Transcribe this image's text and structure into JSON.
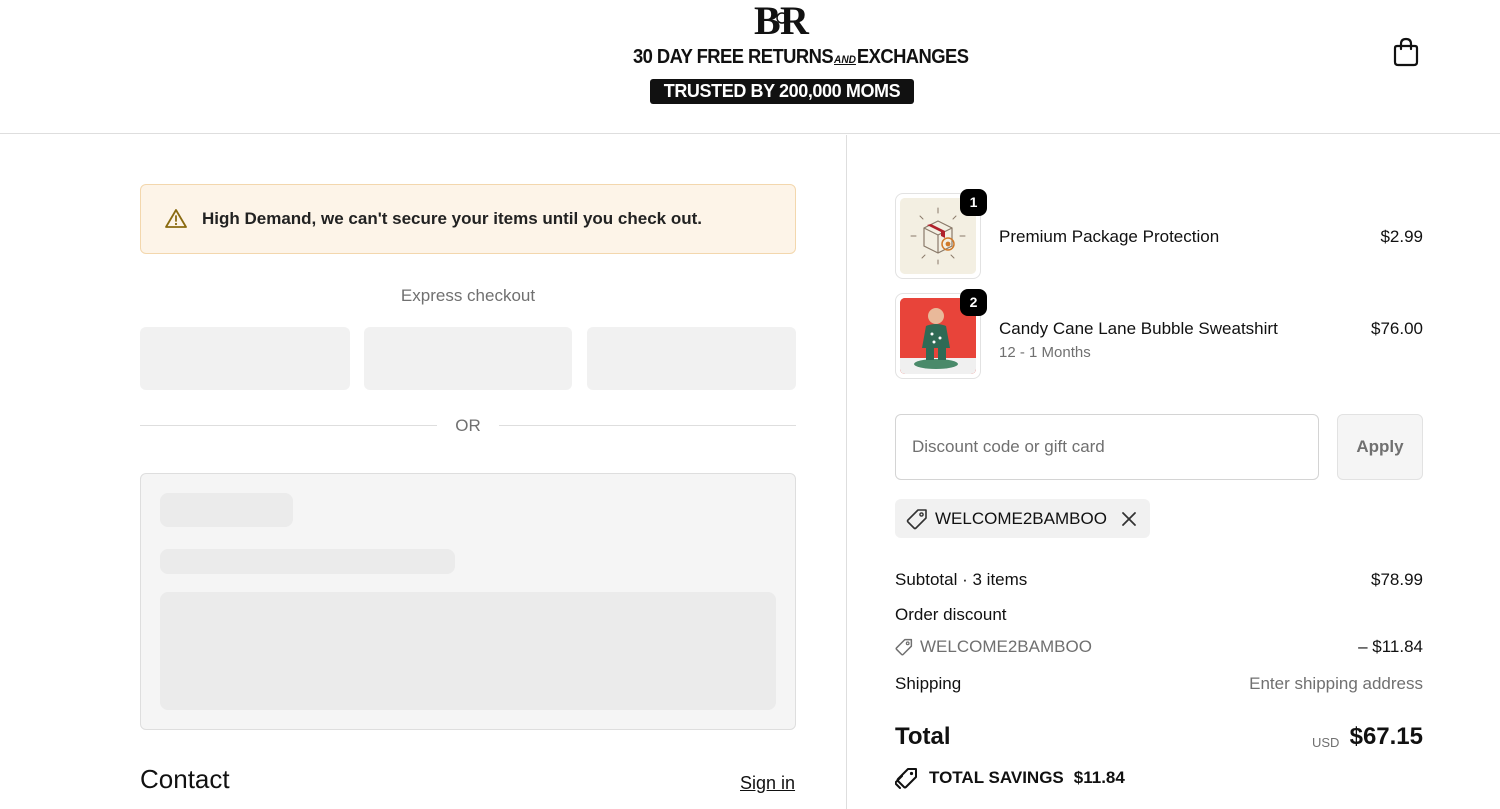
{
  "header": {
    "logo_line1_a": "30 DAY FREE RETURNS",
    "logo_line1_and": "AND",
    "logo_line1_b": "EXCHANGES",
    "logo_line2": "TRUSTED BY 200,000 MOMS",
    "cart_icon": "shopping-bag-icon"
  },
  "banner": {
    "icon": "warning-icon",
    "text": "High Demand, we can't secure your items until you check out.",
    "background": "#fdf4e8",
    "border": "#f3d7ad"
  },
  "express": {
    "label": "Express checkout",
    "or_label": "OR"
  },
  "contact": {
    "title": "Contact",
    "sign_in": "Sign in"
  },
  "cart": {
    "items": [
      {
        "name": "Premium Package Protection",
        "variant": "",
        "price": "$2.99",
        "quantity": "1"
      },
      {
        "name": "Candy Cane Lane Bubble Sweatshirt",
        "variant": "12 - 1 Months",
        "price": "$76.00",
        "quantity": "2"
      }
    ]
  },
  "discount": {
    "placeholder": "Discount code or gift card",
    "apply_label": "Apply",
    "applied_code": "WELCOME2BAMBOO"
  },
  "summary": {
    "subtotal_label": "Subtotal · 3 items",
    "subtotal_value": "$78.99",
    "order_discount_label": "Order discount",
    "discount_code": "WELCOME2BAMBOO",
    "discount_value": "– $11.84",
    "shipping_label": "Shipping",
    "shipping_value": "Enter shipping address",
    "total_label": "Total",
    "currency": "USD",
    "total_value": "$67.15",
    "savings_label": "TOTAL SAVINGS",
    "savings_value": "$11.84"
  }
}
